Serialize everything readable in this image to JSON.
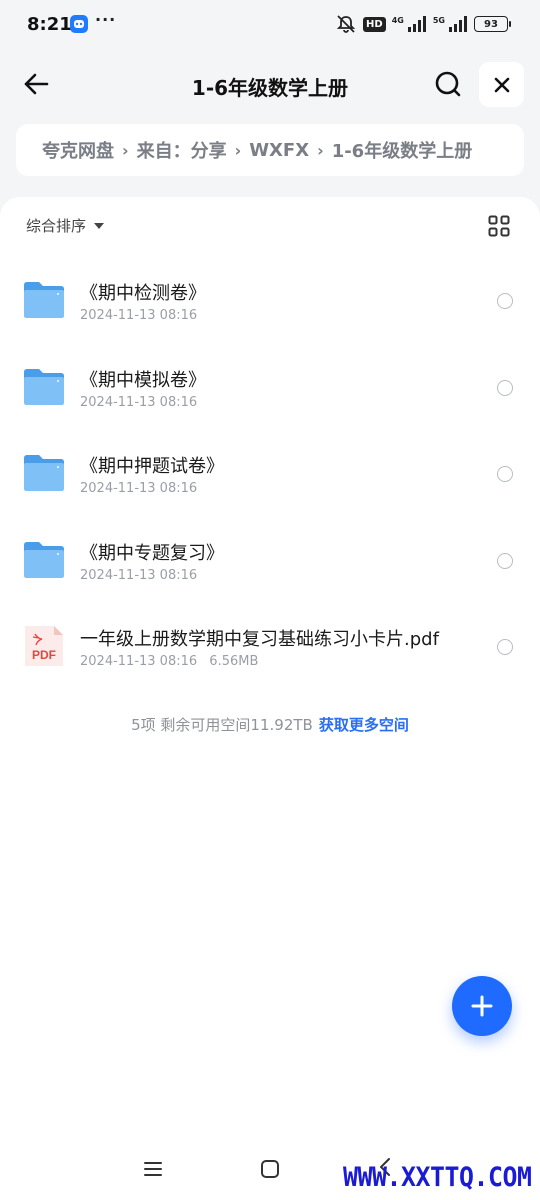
{
  "status_bar": {
    "time": "8:21",
    "dots": "···",
    "hd": "HD",
    "net1": "4G",
    "net2": "5G",
    "battery": "93"
  },
  "header": {
    "title": "1-6年级数学上册"
  },
  "breadcrumb": {
    "items": [
      "夸克网盘",
      "来自：分享",
      "WXFX",
      "1-6年级数学上册"
    ]
  },
  "sort": {
    "label": "综合排序"
  },
  "files": [
    {
      "name": "《期中检测卷》",
      "date": "2024-11-13 08:16",
      "size": "",
      "type": "folder"
    },
    {
      "name": "《期中模拟卷》",
      "date": "2024-11-13 08:16",
      "size": "",
      "type": "folder"
    },
    {
      "name": "《期中押题试卷》",
      "date": "2024-11-13 08:16",
      "size": "",
      "type": "folder"
    },
    {
      "name": "《期中专题复习》",
      "date": "2024-11-13 08:16",
      "size": "",
      "type": "folder"
    },
    {
      "name": "一年级上册数学期中复习基础练习小卡片.pdf",
      "date": "2024-11-13 08:16",
      "size": "6.56MB",
      "type": "pdf",
      "badge": "PDF"
    }
  ],
  "footer": {
    "summary": "5项 剩余可用空间11.92TB",
    "more_space": "获取更多空间"
  },
  "watermark": "WWW.XXTTQ.COM",
  "colors": {
    "accent": "#1f6bff",
    "folder": "#5aa9f0",
    "pdf": "#e8453c"
  },
  "icons": {
    "back": "arrow-left-icon",
    "search": "search-icon",
    "close": "close-icon",
    "grid": "grid-view-icon",
    "fab": "plus-icon"
  }
}
